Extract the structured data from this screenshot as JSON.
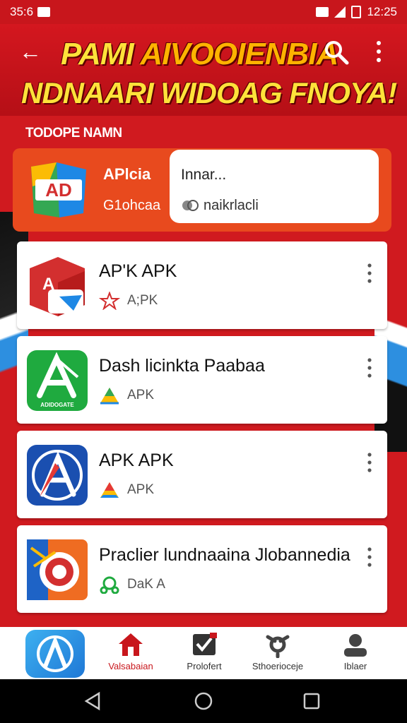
{
  "status_bar": {
    "left_text": "35:6",
    "time": "12:25"
  },
  "header": {
    "title_line1_a": "PAMI ",
    "title_line1_b": "AIVOOIENBIA",
    "title_line2": "NDNAARI WIDOAG FNOYA!"
  },
  "section_label": "TODOPE NAMN",
  "featured": {
    "icon_label": "AD",
    "name": "APlcia",
    "subtitle": "G1ohcaa",
    "panel_title": "Innar...",
    "panel_sub": "naikrlacli"
  },
  "apps": [
    {
      "name": "AP'K APK",
      "tag": "A;PK",
      "icon_text": "A"
    },
    {
      "name": "Dash licinkta Paabaa",
      "tag": "APK",
      "icon_text": "A",
      "icon_caption": "ADIDOGATE"
    },
    {
      "name": "APK APK",
      "tag": "APK",
      "icon_text": "A"
    },
    {
      "name": "Praclier lundnaaina Jlobannedia",
      "tag": "DaK A",
      "icon_text": ""
    }
  ],
  "bottom_nav": [
    {
      "label": "Valsabaian",
      "icon": "home-icon",
      "active": true
    },
    {
      "label": "Prolofert",
      "icon": "image-icon",
      "active": false
    },
    {
      "label": "Sthoerioceje",
      "icon": "settings-icon",
      "active": false
    },
    {
      "label": "Iblaer",
      "icon": "profile-icon",
      "active": false
    }
  ],
  "colors": {
    "brand_red": "#c8161c",
    "title_yellow": "#ffe23a",
    "accent_blue": "#1f78d6"
  }
}
